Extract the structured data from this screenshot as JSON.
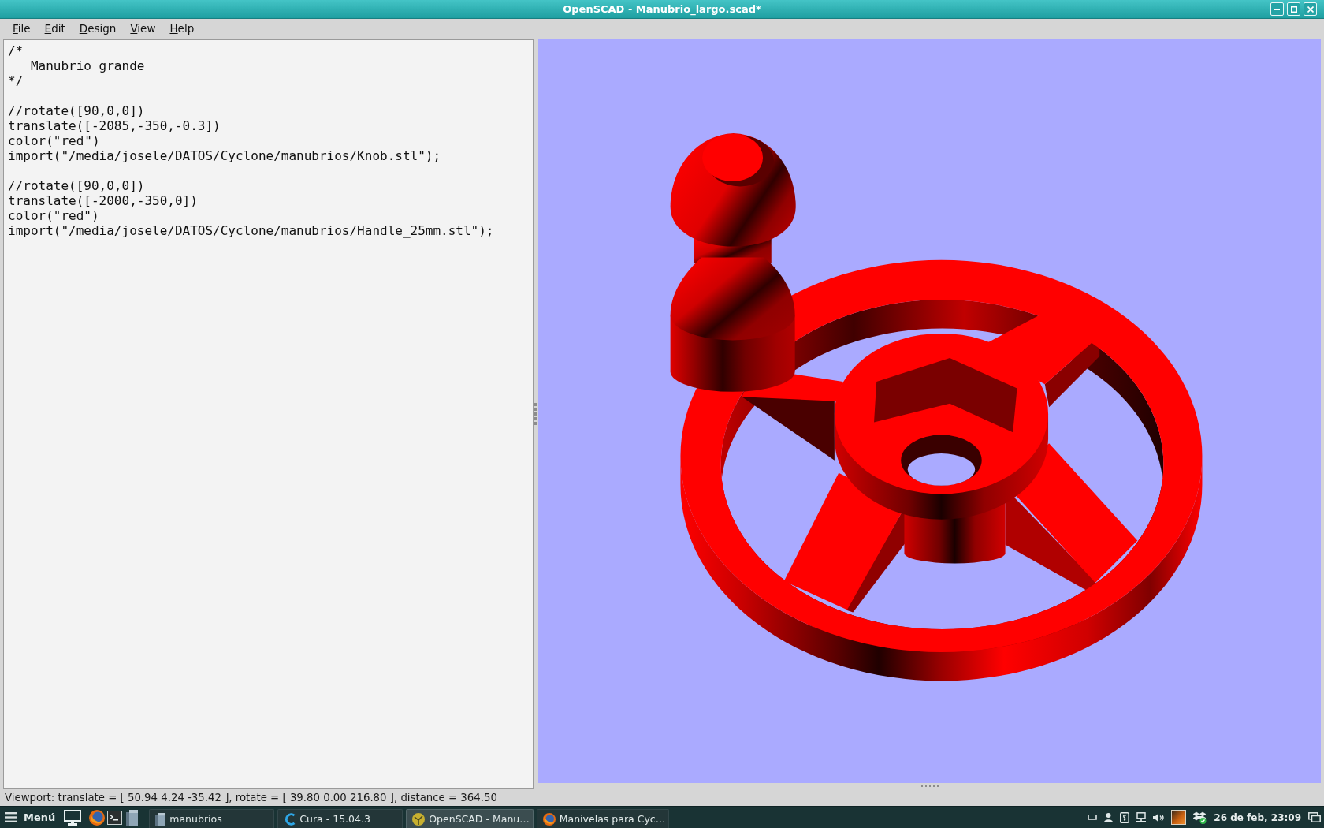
{
  "window": {
    "title": "OpenSCAD - Manubrio_largo.scad*"
  },
  "menu": [
    "File",
    "Edit",
    "Design",
    "View",
    "Help"
  ],
  "editor": {
    "lines": [
      {
        "kind": "code",
        "text": "/*"
      },
      {
        "kind": "code",
        "text": "   Manubrio grande"
      },
      {
        "kind": "code",
        "text": "*/"
      },
      {
        "kind": "blank"
      },
      {
        "kind": "code",
        "text": "//rotate([90,0,0])"
      },
      {
        "kind": "code",
        "text": "translate([-2085,-350,-0.3])"
      },
      {
        "kind": "caret",
        "text": "color(\"red",
        "after_caret": "\")"
      },
      {
        "kind": "code",
        "text": "import(\"/media/josele/DATOS/Cyclone/manubrios/Knob.stl\");"
      },
      {
        "kind": "blank"
      },
      {
        "kind": "code",
        "text": "//rotate([90,0,0])"
      },
      {
        "kind": "code",
        "text": "translate([-2000,-350,0])"
      },
      {
        "kind": "code",
        "text": "color(\"red\")"
      },
      {
        "kind": "code",
        "text": "import(\"/media/josele/DATOS/Cyclone/manubrios/Handle_25mm.stl\");"
      }
    ]
  },
  "status_bar": {
    "text": "Viewport: translate = [ 50.94 4.24 -35.42 ], rotate = [ 39.80 0.00 216.80 ], distance = 364.50"
  },
  "taskbar": {
    "menu_label": "Menú",
    "tasks": [
      {
        "kind": "folder",
        "label": "manubrios",
        "selected": false
      },
      {
        "kind": "c-logo",
        "label": "Cura - 15.04.3",
        "selected": false
      },
      {
        "kind": "sphere",
        "label": "OpenSCAD - Manu…",
        "selected": true
      },
      {
        "kind": "globe",
        "label": "Manivelas para Cyc…",
        "selected": false
      }
    ],
    "clock": "26 de feb, 23:09"
  }
}
